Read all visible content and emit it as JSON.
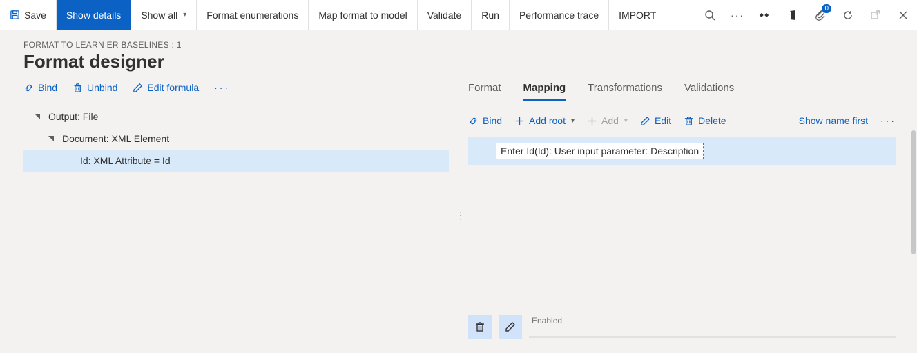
{
  "cmdbar": {
    "save": "Save",
    "show_details": "Show details",
    "show_all": "Show all",
    "format_enum": "Format enumerations",
    "map_to_model": "Map format to model",
    "validate": "Validate",
    "run": "Run",
    "perf_trace": "Performance trace",
    "import": "IMPORT",
    "badge_count": "0"
  },
  "header": {
    "breadcrumb": "FORMAT TO LEARN ER BASELINES : 1",
    "title": "Format designer"
  },
  "left": {
    "bind": "Bind",
    "unbind": "Unbind",
    "edit_formula": "Edit formula",
    "tree": {
      "n0": "Output: File",
      "n1": "Document: XML Element",
      "n2": "Id: XML Attribute = Id"
    }
  },
  "right": {
    "tabs": {
      "format": "Format",
      "mapping": "Mapping",
      "transformations": "Transformations",
      "validations": "Validations"
    },
    "strip": {
      "bind": "Bind",
      "add_root": "Add root",
      "add": "Add",
      "edit": "Edit",
      "delete": "Delete",
      "name_first": "Show name first"
    },
    "mapping_row": "Enter Id(Id): User input parameter: Description",
    "enabled_label": "Enabled"
  }
}
